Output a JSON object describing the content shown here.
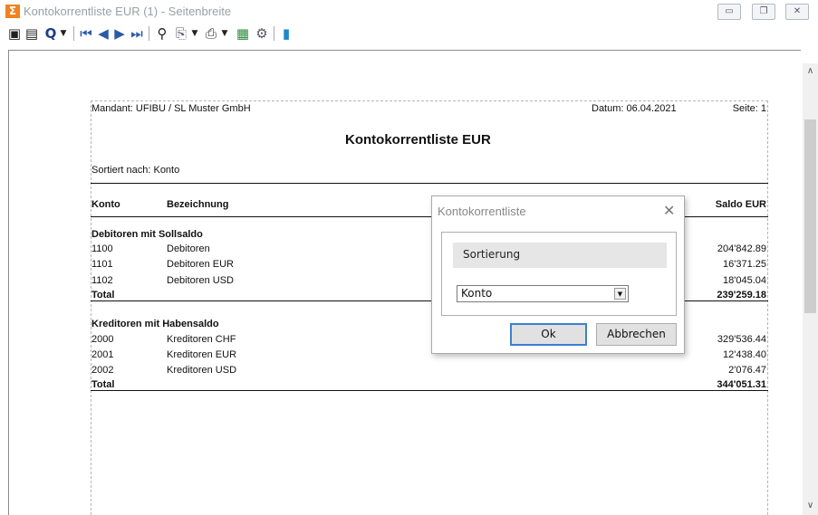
{
  "window": {
    "title": "Kontokorrentliste EUR (1) - Seitenbreite",
    "minimize": "▭",
    "restore": "❐",
    "close": "✕"
  },
  "toolbar": {
    "icons": [
      "single-page-icon",
      "page-setup-icon",
      "zoom-icon",
      "zoom-dropdown-icon",
      "first-page-icon",
      "prev-page-icon",
      "next-page-icon",
      "last-page-icon",
      "find-icon",
      "export-icon",
      "export-dropdown-icon",
      "print-icon",
      "print-dropdown-icon",
      "excel-icon",
      "settings-icon",
      "exit-icon"
    ]
  },
  "report": {
    "mandant": "Mandant: UFIBU / SL Muster GmbH",
    "datum": "Datum: 06.04.2021",
    "seite": "Seite: 1",
    "title": "Kontokorrentliste EUR",
    "sortiert": "Sortiert nach: Konto",
    "columns": {
      "konto": "Konto",
      "bezeichnung": "Bezeichnung",
      "saldo": "Saldo EUR"
    },
    "groups": [
      {
        "heading": "Debitoren mit Sollsaldo",
        "rows": [
          {
            "konto": "1100",
            "bezeichnung": "Debitoren",
            "saldo": "204'842.89"
          },
          {
            "konto": "1101",
            "bezeichnung": "Debitoren EUR",
            "saldo": "16'371.25"
          },
          {
            "konto": "1102",
            "bezeichnung": "Debitoren USD",
            "saldo": "18'045.04"
          }
        ],
        "total_label": "Total",
        "total": "239'259.18"
      },
      {
        "heading": "Kreditoren mit Habensaldo",
        "rows": [
          {
            "konto": "2000",
            "bezeichnung": "Kreditoren CHF",
            "saldo": "329'536.44"
          },
          {
            "konto": "2001",
            "bezeichnung": "Kreditoren EUR",
            "saldo": "12'438.40"
          },
          {
            "konto": "2002",
            "bezeichnung": "Kreditoren USD",
            "saldo": "2'076.47"
          }
        ],
        "total_label": "Total",
        "total": "344'051.31"
      }
    ]
  },
  "dialog": {
    "title": "Kontokorrentliste",
    "close": "✕",
    "group_label": "Sortierung",
    "select_value": "Konto",
    "ok": "Ok",
    "cancel": "Abbrechen"
  },
  "colors": {
    "accent": "#3c7fd3",
    "app_icon": "#f0821f"
  }
}
